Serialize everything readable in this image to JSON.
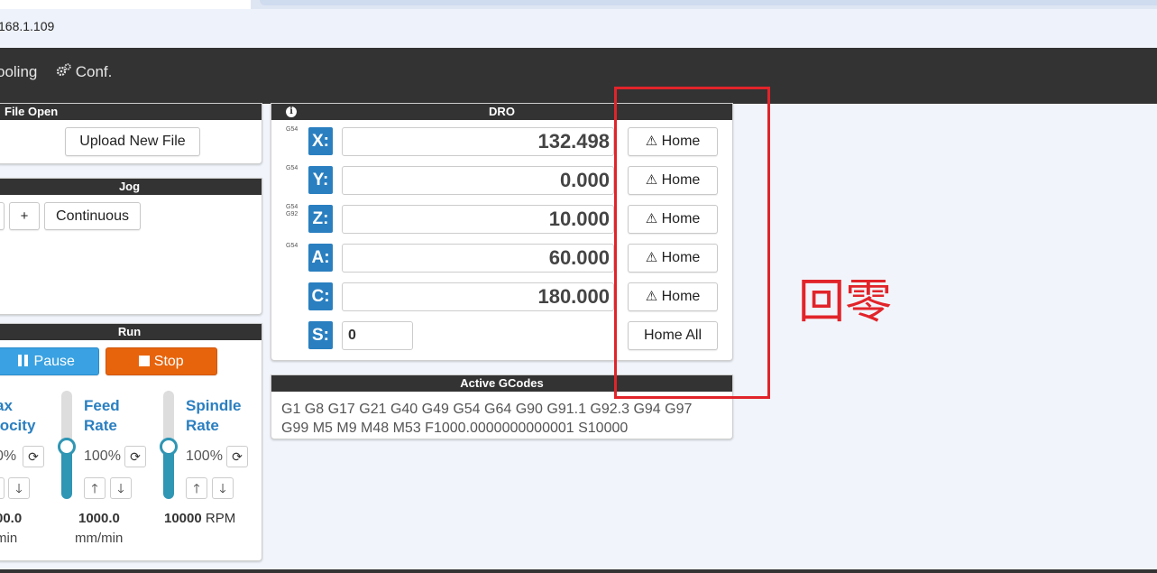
{
  "browser": {
    "url": "168.1.109"
  },
  "navbar": {
    "tooling_label": "ooling",
    "conf_label": "Conf."
  },
  "file_open": {
    "title": "File Open",
    "upload_label": "Upload New File"
  },
  "jog": {
    "title": "Jog",
    "plus_label": "+",
    "continuous_label": "Continuous"
  },
  "run": {
    "title": "Run",
    "pause_label": "Pause",
    "stop_label": "Stop",
    "max_velocity": {
      "label_line1": "ax",
      "label_line2": "locity",
      "percent": "0%",
      "value": "00.0",
      "unit": "min"
    },
    "feed_rate": {
      "label_line1": "Feed",
      "label_line2": "Rate",
      "percent": "100%",
      "value": "1000.0",
      "unit": "mm/min",
      "level": 0.5
    },
    "spindle_rate": {
      "label_line1": "Spindle",
      "label_line2": "Rate",
      "percent": "100%",
      "value": "10000",
      "unit": "RPM",
      "level": 0.5
    }
  },
  "dro": {
    "title": "DRO",
    "axes": [
      {
        "label": "X:",
        "value": "132.498",
        "gcode": "G54",
        "gcode2": "",
        "home_label": "Home"
      },
      {
        "label": "Y:",
        "value": "0.000",
        "gcode": "G54",
        "gcode2": "",
        "home_label": "Home"
      },
      {
        "label": "Z:",
        "value": "10.000",
        "gcode": "G54",
        "gcode2": "G92",
        "home_label": "Home"
      },
      {
        "label": "A:",
        "value": "60.000",
        "gcode": "G54",
        "gcode2": "",
        "home_label": "Home"
      },
      {
        "label": "C:",
        "value": "180.000",
        "gcode": "",
        "gcode2": "",
        "home_label": "Home"
      }
    ],
    "spindle": {
      "label": "S:",
      "value": "0"
    },
    "home_all_label": "Home All"
  },
  "active_gcodes": {
    "title": "Active GCodes",
    "line1": "G1 G8 G17 G21 G40 G49 G54 G64 G90 G91.1 G92.3 G94 G97",
    "line2": "G99 M5 M9 M48 M53 F1000.0000000000001 S10000"
  },
  "annotation": {
    "text": "回零",
    "color": "#e1242a"
  },
  "colors": {
    "accent": "#2a7fc0",
    "stop": "#e8640c",
    "pause": "#3aa2e2"
  }
}
